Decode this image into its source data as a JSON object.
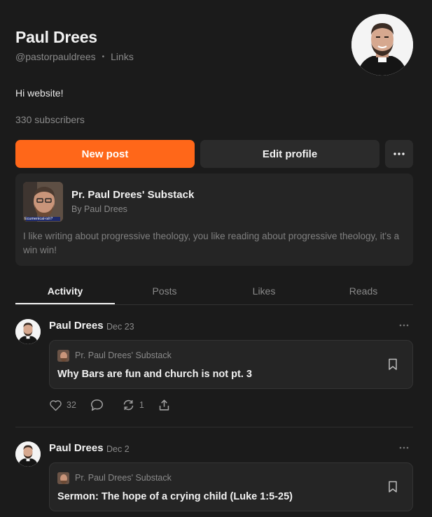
{
  "profile": {
    "name": "Paul Drees",
    "handle": "@pastorpauldrees",
    "links_label": "Links",
    "bio": "Hi website!",
    "subscribers": "330 subscribers"
  },
  "buttons": {
    "new_post": "New post",
    "edit_profile": "Edit profile",
    "more": "···"
  },
  "publication": {
    "title": "Pr. Paul Drees' Substack",
    "byline": "By Paul Drees",
    "description": "I like writing about progressive theology, you like reading about progressive theology, it's a win win!",
    "thumb_caption": "Ecumenical-ish?"
  },
  "tabs": [
    {
      "label": "Activity",
      "active": true
    },
    {
      "label": "Posts",
      "active": false
    },
    {
      "label": "Likes",
      "active": false
    },
    {
      "label": "Reads",
      "active": false
    }
  ],
  "posts": [
    {
      "author": "Paul Drees",
      "date": "Dec 23",
      "publication": "Pr. Paul Drees' Substack",
      "title": "Why Bars are fun and church is not pt. 3",
      "likes": "32",
      "restacks": "1"
    },
    {
      "author": "Paul Drees",
      "date": "Dec 2",
      "publication": "Pr. Paul Drees' Substack",
      "title": "Sermon: The hope of a crying child (Luke 1:5-25)"
    }
  ],
  "colors": {
    "accent": "#ff6719",
    "background": "#1b1b1b",
    "card": "#252525"
  }
}
